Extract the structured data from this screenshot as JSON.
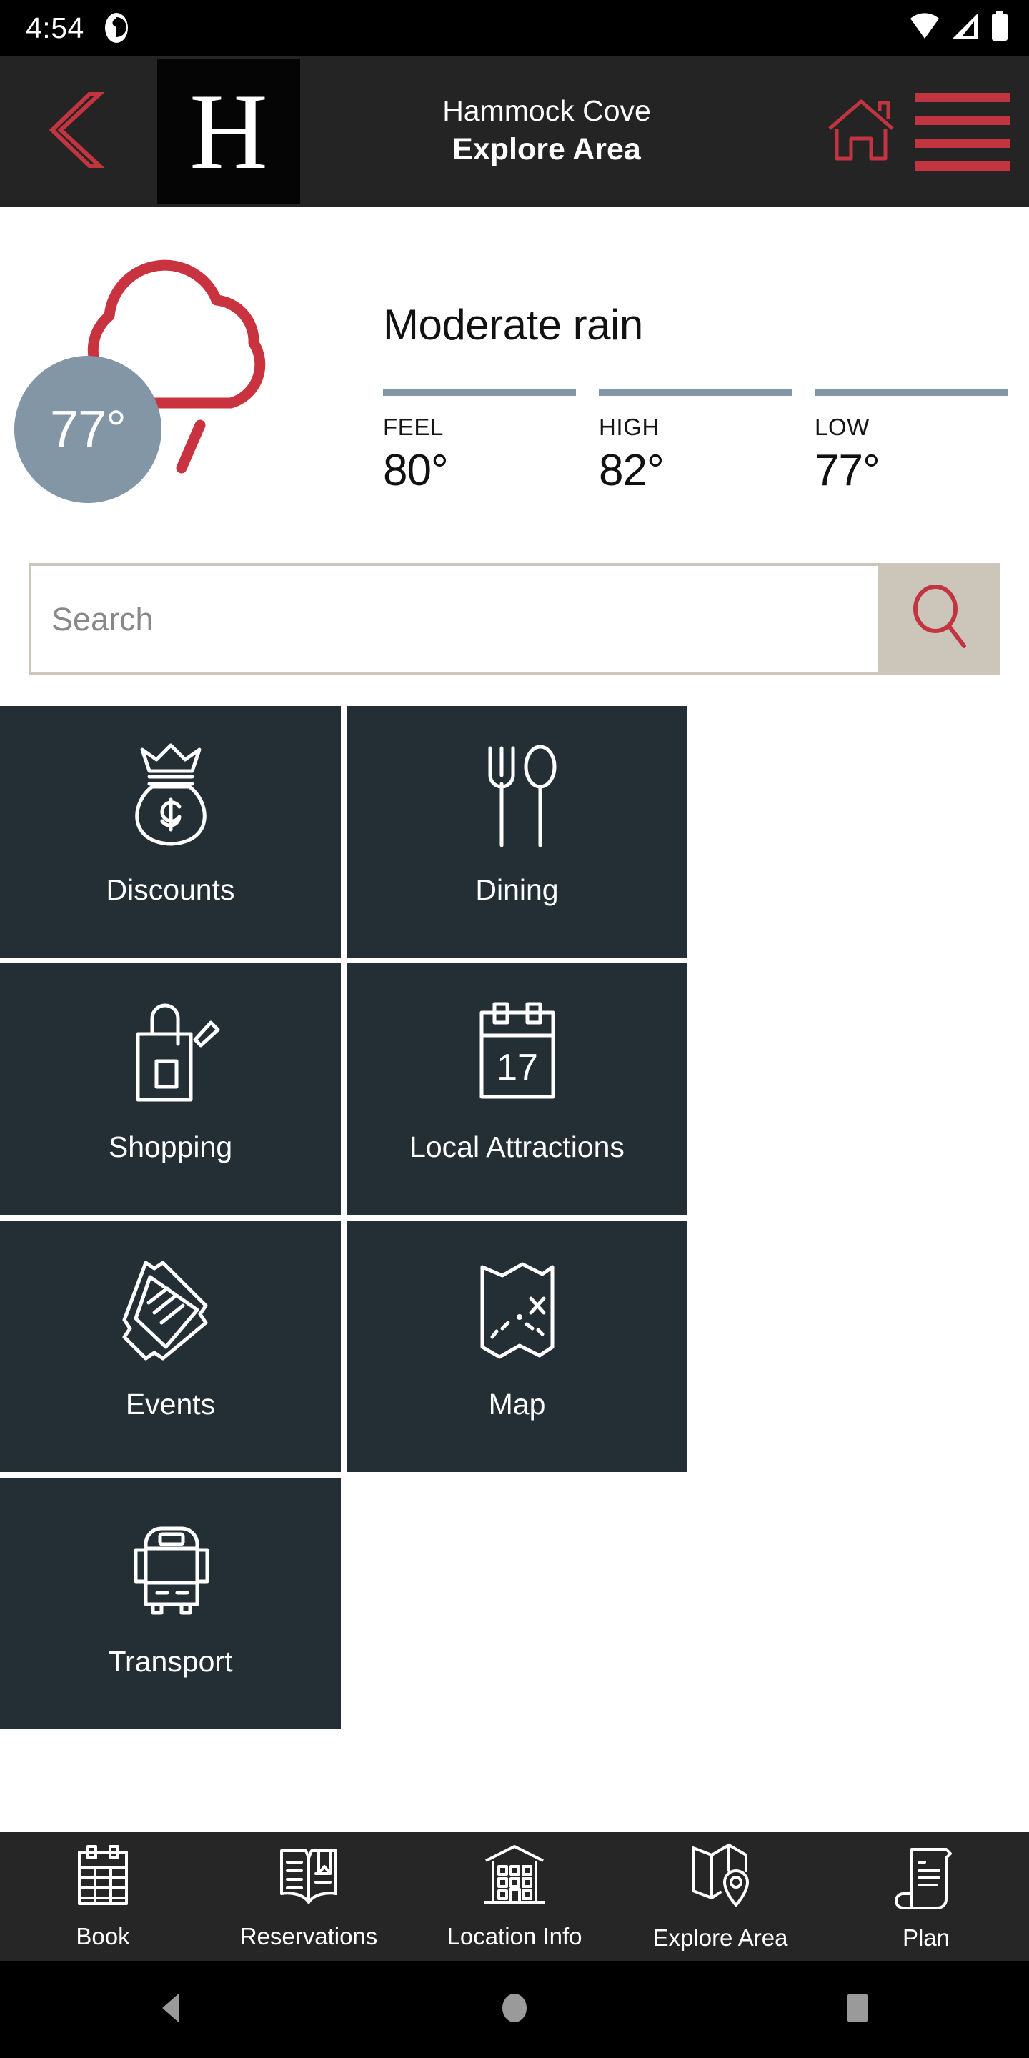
{
  "status_bar": {
    "time": "4:54",
    "notification_icon": "notification-dot-icon",
    "wifi_icon": "wifi-icon",
    "signal_icon": "cell-signal-icon",
    "battery_icon": "battery-full-icon"
  },
  "header": {
    "back_icon": "chevron-left-icon",
    "logo_letter": "H",
    "property_name": "Hammock Cove",
    "page_title": "Explore Area",
    "home_icon": "home-icon",
    "menu_icon": "hamburger-menu-icon",
    "accent_color": "#c13440",
    "bar_color": "#242424"
  },
  "weather": {
    "current_temp": "77°",
    "condition": "Moderate rain",
    "icon": "rain-cloud-icon",
    "badge_color": "#8296a6",
    "rule_color": "#8296a6",
    "metrics": [
      {
        "label": "FEEL",
        "value": "80°"
      },
      {
        "label": "HIGH",
        "value": "82°"
      },
      {
        "label": "LOW",
        "value": "77°"
      }
    ]
  },
  "search": {
    "placeholder": "Search",
    "value": "",
    "button_icon": "magnifier-icon",
    "frame_color": "#cbc5ba",
    "icon_color": "#c13440"
  },
  "tiles": {
    "background_color": "#242f35",
    "items": [
      {
        "label": "Discounts",
        "icon": "money-bag-crown-icon"
      },
      {
        "label": "Dining",
        "icon": "fork-spoon-icon"
      },
      {
        "label": "Shopping",
        "icon": "shopping-bag-tag-icon"
      },
      {
        "label": "Local Attractions",
        "icon": "calendar-17-icon"
      },
      {
        "label": "Events",
        "icon": "tickets-icon"
      },
      {
        "label": "Map",
        "icon": "treasure-map-x-icon"
      },
      {
        "label": "Transport",
        "icon": "bus-icon"
      }
    ],
    "calendar_day": "17"
  },
  "bottom_nav": {
    "background_color": "#262626",
    "items": [
      {
        "label": "Book",
        "icon": "calendar-grid-icon"
      },
      {
        "label": "Reservations",
        "icon": "open-book-bookmark-icon"
      },
      {
        "label": "Location Info",
        "icon": "building-icon"
      },
      {
        "label": "Explore Area",
        "icon": "folded-map-pin-icon"
      },
      {
        "label": "Plan",
        "icon": "scroll-document-icon"
      }
    ]
  },
  "android_nav": {
    "back_icon": "android-back-triangle-icon",
    "home_icon": "android-home-circle-icon",
    "recents_icon": "android-recents-square-icon"
  }
}
